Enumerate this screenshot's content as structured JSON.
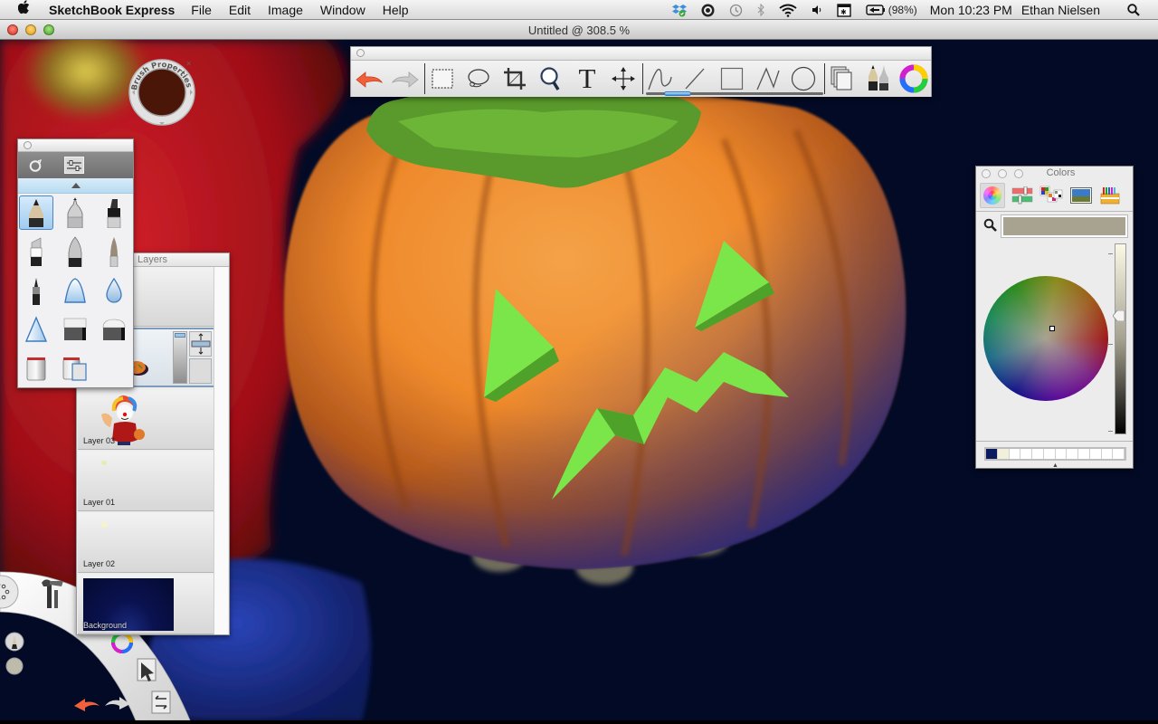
{
  "menubar": {
    "app_name": "SketchBook Express",
    "menus": [
      "File",
      "Edit",
      "Image",
      "Window",
      "Help"
    ],
    "status_icons": [
      "dropbox-icon",
      "sync-icon",
      "time-machine-icon",
      "bluetooth-icon",
      "wifi-icon",
      "volume-icon",
      "input-menu-icon",
      "battery-icon"
    ],
    "battery_percent": "(98%)",
    "clock": "Mon 10:23 PM",
    "user": "Ethan Nielsen"
  },
  "window": {
    "title": "Untitled @ 308.5 %"
  },
  "toolbar": {
    "tools": [
      {
        "name": "undo",
        "icon": "undo-arrow-icon"
      },
      {
        "name": "redo",
        "icon": "redo-arrow-icon"
      },
      {
        "name": "rectangle-select",
        "icon": "marquee-icon"
      },
      {
        "name": "lasso-select",
        "icon": "lasso-icon"
      },
      {
        "name": "crop",
        "icon": "crop-icon"
      },
      {
        "name": "zoom",
        "icon": "magnifier-icon"
      },
      {
        "name": "text",
        "icon": "text-icon",
        "glyph": "T"
      },
      {
        "name": "move",
        "icon": "move-arrows-icon"
      },
      {
        "name": "freehand-stroke",
        "icon": "freehand-icon"
      },
      {
        "name": "line",
        "icon": "line-icon"
      },
      {
        "name": "rectangle",
        "icon": "rectangle-icon"
      },
      {
        "name": "polyline",
        "icon": "polyline-icon"
      },
      {
        "name": "ellipse",
        "icon": "ellipse-icon"
      },
      {
        "name": "layers",
        "icon": "layers-stack-icon"
      },
      {
        "name": "brushes",
        "icon": "brushes-icon"
      },
      {
        "name": "color-wheel",
        "icon": "color-wheel-icon"
      }
    ],
    "stroke_slider_value": 0.12
  },
  "brush_properties": {
    "label": "Brush Properties"
  },
  "brush_palette": {
    "modes": [
      "brush-puck-icon",
      "sliders-icon"
    ],
    "brushes": [
      {
        "name": "pencil",
        "selected": true
      },
      {
        "name": "ballpoint-pen",
        "selected": false
      },
      {
        "name": "marker",
        "selected": false
      },
      {
        "name": "chisel-marker",
        "selected": false
      },
      {
        "name": "fine-pen",
        "selected": false
      },
      {
        "name": "paint-brush",
        "selected": false
      },
      {
        "name": "felt-tip",
        "selected": false
      },
      {
        "name": "airbrush",
        "selected": false
      },
      {
        "name": "smudge-drop",
        "selected": false
      },
      {
        "name": "hard-airbrush",
        "selected": false
      },
      {
        "name": "hard-eraser",
        "selected": false
      },
      {
        "name": "soft-eraser",
        "selected": false
      },
      {
        "name": "fill-bucket",
        "selected": false
      },
      {
        "name": "fill-bucket-layer",
        "selected": false
      }
    ]
  },
  "layers": {
    "title": "Layers",
    "items": [
      {
        "name": "",
        "active": false
      },
      {
        "name": "",
        "active": true
      },
      {
        "name": "Layer 03",
        "active": false
      },
      {
        "name": "Layer 01",
        "active": false
      },
      {
        "name": "Layer 02",
        "active": false
      },
      {
        "name": "Background",
        "active": false
      }
    ],
    "active_opacity": 1.0
  },
  "colors_panel": {
    "title": "Colors",
    "modes": [
      "color-wheel-mode",
      "sliders-mode",
      "palettes-mode",
      "image-palettes-mode",
      "crayons-mode"
    ],
    "current_color": "#a8a390",
    "brightness": 0.62,
    "swatches": [
      "#0a1a5c",
      "#f2f0dc",
      "#ffffff",
      "#ffffff",
      "#ffffff",
      "#ffffff",
      "#ffffff",
      "#ffffff",
      "#ffffff",
      "#ffffff",
      "#ffffff",
      "#ffffff"
    ]
  },
  "lagoon": {
    "items": [
      "settings-dots-icon",
      "tools-icon",
      "pencil-preview-icon",
      "color-preview-icon",
      "color-ring-icon",
      "cursor-select-icon",
      "layer-swap-icon",
      "undo-icon",
      "redo-icon"
    ]
  }
}
